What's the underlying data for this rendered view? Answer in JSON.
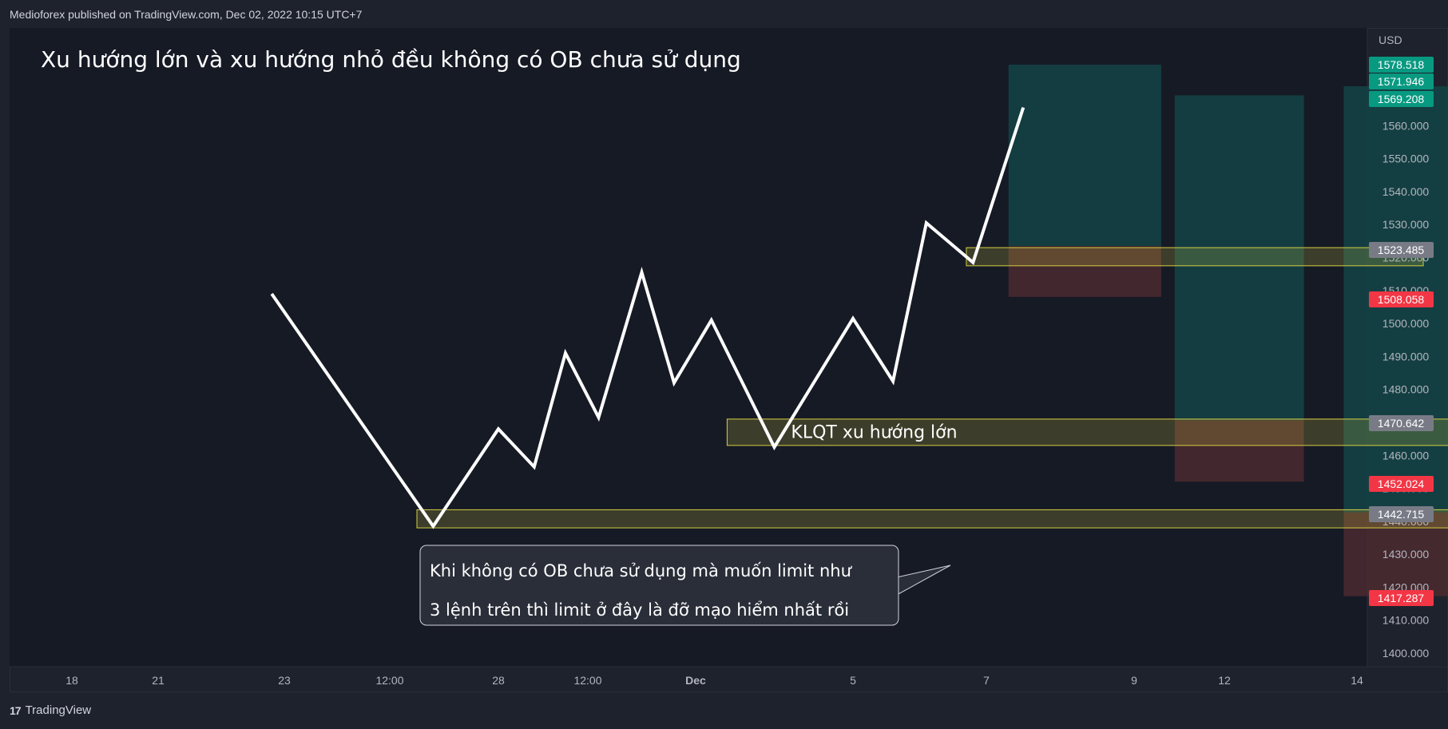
{
  "header": {
    "published": "Medioforex published on TradingView.com, Dec 02, 2022 10:15 UTC+7"
  },
  "footer": {
    "logo_icon": "tradingview-logo-icon",
    "brand": "TradingView"
  },
  "colors": {
    "background": "#1e222d",
    "price_line": "#ffffff",
    "profit_zone": "#134446",
    "loss_zone": "#4b2a30",
    "zone_box": "#d5cf43",
    "badge_green": "#089981",
    "badge_red": "#f23645",
    "badge_gray": "#787b86"
  },
  "chart_data": {
    "type": "line",
    "title": "Xu hướng lớn và xu hướng nhỏ đều không có OB chưa sử dụng",
    "currency": "USD",
    "ylim": [
      1395,
      1590
    ],
    "x_ticks": [
      "18",
      "21",
      "23",
      "12:00",
      "28",
      "12:00",
      "Dec",
      "5",
      "7",
      "9",
      "12",
      "14"
    ],
    "y_ticks": [
      1400,
      1410,
      1420,
      1430,
      1440,
      1450,
      1460,
      1470,
      1480,
      1490,
      1500,
      1510,
      1520,
      1530,
      1540,
      1550,
      1560
    ],
    "price_path": [
      1509,
      1438.5,
      1468,
      1456.5,
      1491,
      1471.5,
      1515.5,
      1482,
      1501,
      1462.5,
      1501.5,
      1482.5,
      1530.5,
      1518.5,
      1565.5
    ],
    "price_path_ticks": [
      1.9,
      3.4,
      4.0,
      4.4,
      4.75,
      5.1,
      5.5,
      5.8,
      6.1,
      6.5,
      7.0,
      7.3,
      7.55,
      7.9,
      8.25
    ],
    "positions": [
      {
        "kind": "short-then-long",
        "x_range_ticks": [
          8.15,
          9.3
        ],
        "profit_top": 1578.518,
        "entry": 1523.485,
        "stop": 1508.058
      },
      {
        "kind": "long",
        "x_range_ticks": [
          9.45,
          10.6
        ],
        "profit_top": 1569.208,
        "entry": 1470.642,
        "stop": 1452.024
      },
      {
        "kind": "long",
        "x_range_ticks": [
          10.9,
          13.35
        ],
        "profit_top": 1571.946,
        "entry": 1442.715,
        "stop": 1417.287
      }
    ],
    "zones": [
      {
        "label": "",
        "x_range_ticks": [
          7.85,
          11.5
        ],
        "price_range": [
          1517.5,
          1523
        ]
      },
      {
        "label": "KLQT xu hướng lớn",
        "x_range_ticks": [
          6.2,
          12.25
        ],
        "price_range": [
          1463,
          1471
        ]
      },
      {
        "label": "",
        "x_range_ticks": [
          3.25,
          12.6
        ],
        "price_range": [
          1438,
          1443.5
        ]
      }
    ],
    "price_badges": [
      {
        "value": "1578.518",
        "color": "green"
      },
      {
        "value": "1571.946",
        "color": "green"
      },
      {
        "value": "1569.208",
        "color": "green"
      },
      {
        "value": "1523.485",
        "color": "gray"
      },
      {
        "value": "1508.058",
        "color": "red"
      },
      {
        "value": "1470.642",
        "color": "gray"
      },
      {
        "value": "1452.024",
        "color": "red"
      },
      {
        "value": "1442.715",
        "color": "gray"
      },
      {
        "value": "1417.287",
        "color": "red"
      }
    ],
    "callout": {
      "lines": [
        "Khi không có OB chưa sử dụng mà muốn limit như",
        "3 lệnh trên thì limit ở đây là đỡ mạo hiểm nhất rồi"
      ]
    }
  }
}
